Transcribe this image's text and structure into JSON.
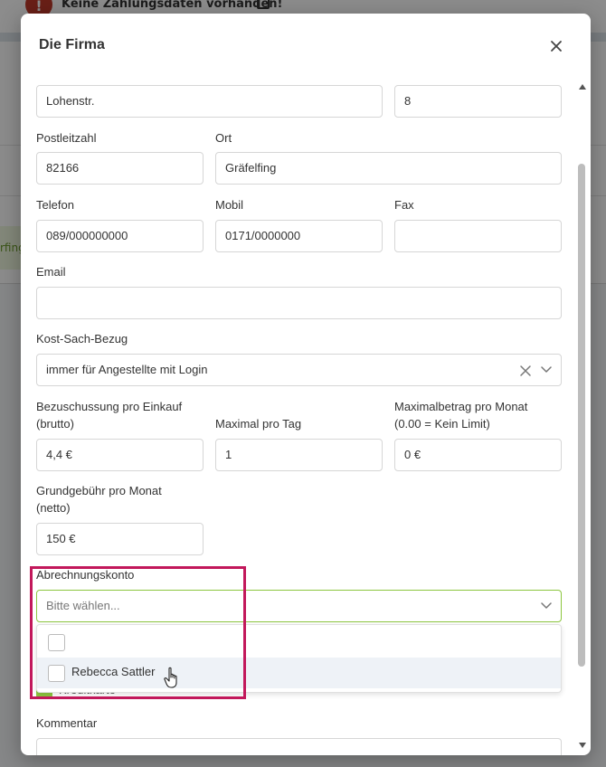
{
  "background": {
    "alert_text": "Keine Zahlungsdaten vorhanden!",
    "side_text": "rfing"
  },
  "modal": {
    "title": "Die Firma",
    "close_icon": "close-icon",
    "street": "Lohenstr.",
    "house_number": "8",
    "postal_code_label": "Postleitzahl",
    "postal_code": "82166",
    "city_label": "Ort",
    "city": "Gräfelfing",
    "phone_label": "Telefon",
    "phone": "089/000000000",
    "mobile_label": "Mobil",
    "mobile": "0171/0000000",
    "fax_label": "Fax",
    "fax": "",
    "email_label": "Email",
    "email": "",
    "cost_label": "Kost-Sach-Bezug",
    "cost_value": "immer für Angestellte mit Login",
    "subsidy_label_1": "Bezuschussung pro Einkauf",
    "subsidy_label_2": "(brutto)",
    "subsidy_value": "4,4 €",
    "max_day_label": "Maximal pro Tag",
    "max_day_value": "1",
    "max_month_label_1": "Maximalbetrag pro Monat",
    "max_month_label_2": "(0.00 = Kein Limit)",
    "max_month_value": "0 €",
    "base_fee_label_1": "Grundgebühr pro Monat",
    "base_fee_label_2": "(netto)",
    "base_fee_value": "150 €",
    "account_label": "Abrechnungskonto",
    "account_placeholder": "Bitte wählen...",
    "account_options": [
      "",
      "Rebecca Sattler"
    ],
    "behind_option_text": "Kreditkarte",
    "comment_label": "Kommentar",
    "comment_value": ""
  },
  "colors": {
    "focus_border": "#8cc63f",
    "highlight_box": "#c2185b",
    "alert_icon": "#c0392b"
  }
}
